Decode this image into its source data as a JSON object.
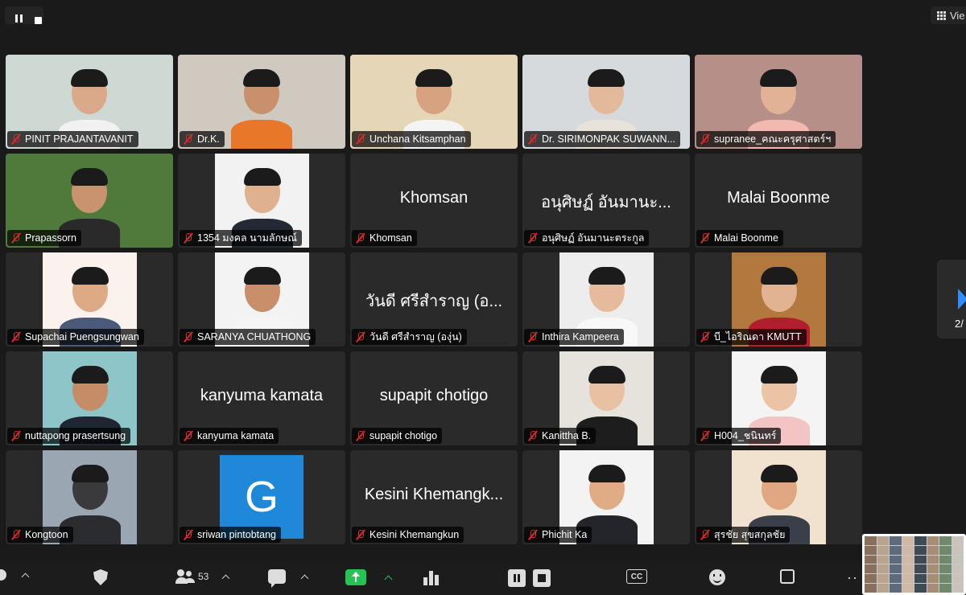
{
  "top_bar": {
    "view_label": "Vie"
  },
  "gallery": {
    "tiles": [
      {
        "name": "PINIT PRAJANTAVANIT",
        "type": "video",
        "bg": "#cfd9d4",
        "shirt": "#f1f1f1",
        "skin": "#d9a98a"
      },
      {
        "name": "Dr.K.",
        "type": "video",
        "bg": "#cfc9c0",
        "shirt": "#e9772a",
        "skin": "#c8906c"
      },
      {
        "name": "Unchana Kitsamphan",
        "type": "video",
        "bg": "#e5d6b8",
        "shirt": "#f4f4f4",
        "skin": "#d6a27f"
      },
      {
        "name": "Dr. SIRIMONPAK SUWANN...",
        "type": "video",
        "bg": "#d7dadd",
        "shirt": "#e8e2da",
        "skin": "#e3b99c"
      },
      {
        "name": "supranee_คณะครุศาสตร์ฯ",
        "type": "video",
        "bg": "#b58f88",
        "shirt": "#f2b9b0",
        "skin": "#e2b296"
      },
      {
        "name": "Prapassorn",
        "type": "video",
        "bg": "#4f7a3c",
        "shirt": "#2a2a2a",
        "skin": "#c9936f"
      },
      {
        "name": "1354 มงคล นามลักษณ์",
        "type": "photo",
        "bg": "#f2f2f2",
        "shirt": "#242a33",
        "skin": "#e0b18f"
      },
      {
        "name": "Khomsan",
        "type": "text",
        "big": "Khomsan"
      },
      {
        "name": "อนุศิษฏ์ อันมานะตระกูล",
        "type": "text",
        "big": "อนุศิษฏ์ อันมานะ..."
      },
      {
        "name": "Malai Boonme",
        "type": "text",
        "big": "Malai Boonme"
      },
      {
        "name": "Supachai Puengsungwan",
        "type": "photo",
        "bg": "#fbf2ee",
        "shirt": "#4a5a78",
        "skin": "#deaa86"
      },
      {
        "name": "SARANYA CHUATHONG",
        "type": "photo",
        "bg": "#f3f3f3",
        "shirt": "#f5f5f5",
        "skin": "#c98e6a"
      },
      {
        "name": "วันดี ศรีสำราญ (องุ่น)",
        "type": "text",
        "big": "วันดี ศรีสำราญ (อ..."
      },
      {
        "name": "Inthira Kampeera",
        "type": "photo",
        "bg": "#ededed",
        "shirt": "#f8f8f8",
        "skin": "#e6bb9d"
      },
      {
        "name": "บี_ไอริณดา KMUTT",
        "type": "photo",
        "bg": "#b3783d",
        "shirt": "#b21f2c",
        "skin": "#e2b393"
      },
      {
        "name": "nuttapong prasertsung",
        "type": "photo",
        "bg": "#8ec5c9",
        "shirt": "#202533",
        "skin": "#c48d68"
      },
      {
        "name": "kanyuma kamata",
        "type": "text",
        "big": "kanyuma kamata"
      },
      {
        "name": "supapit chotigo",
        "type": "text",
        "big": "supapit chotigo"
      },
      {
        "name": "Kanittha B.",
        "type": "photo",
        "bg": "#e6e2dc",
        "shirt": "#1d1d1d",
        "skin": "#e8c0a2"
      },
      {
        "name": "H004_ชนินทร์",
        "type": "photo",
        "bg": "#f4f4f4",
        "shirt": "#f2c4c4",
        "skin": "#ebc3a5"
      },
      {
        "name": "Kongtoon",
        "type": "photo",
        "bg": "#9aa7b3",
        "shirt": "#2a2c30",
        "skin": "#3a3a3c"
      },
      {
        "name": "sriwan pintobtang",
        "type": "avatar",
        "letter": "G"
      },
      {
        "name": "Kesini Khemangkun",
        "type": "text",
        "big": "Kesini Khemangk..."
      },
      {
        "name": "Phichit Ka",
        "type": "photo",
        "bg": "#f3f3f3",
        "shirt": "#23252b",
        "skin": "#e0ac86"
      },
      {
        "name": "สุรชัย สุขสกุลชัย",
        "type": "photo",
        "bg": "#f0e2cf",
        "shirt": "#3a3f4a",
        "skin": "#dfa883"
      }
    ]
  },
  "pagination": {
    "page_text": "2/"
  },
  "toolbar": {
    "participants_count": "53"
  },
  "colors": {
    "accent": "#2d8cff",
    "share_green": "#23c552",
    "mute_red": "#e02828",
    "avatar_blue": "#1f88d8"
  }
}
